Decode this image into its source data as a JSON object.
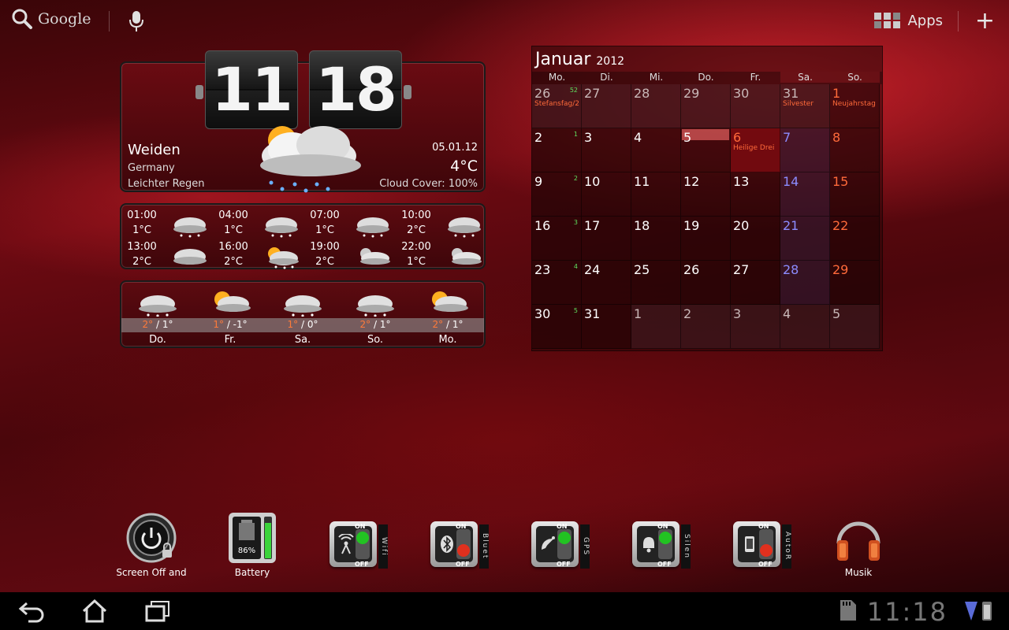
{
  "topbar": {
    "search_label": "Google",
    "apps_label": "Apps"
  },
  "clock": {
    "hours": "11",
    "minutes": "18"
  },
  "weather_now": {
    "city": "Weiden",
    "country": "Germany",
    "condition": "Leichter Regen",
    "date": "05.01.12",
    "temp": "4°C",
    "cloud_cover": "Cloud Cover: 100%"
  },
  "hourly": [
    {
      "time": "01:00",
      "temp": "1°C",
      "icon": "snow-cloud-icon"
    },
    {
      "time": "04:00",
      "temp": "1°C",
      "icon": "snow-cloud-icon"
    },
    {
      "time": "07:00",
      "temp": "1°C",
      "icon": "snow-cloud-icon"
    },
    {
      "time": "10:00",
      "temp": "2°C",
      "icon": "snow-cloud-icon"
    },
    {
      "time": "13:00",
      "temp": "2°C",
      "icon": "cloud-icon"
    },
    {
      "time": "16:00",
      "temp": "2°C",
      "icon": "sun-snow-cloud-icon"
    },
    {
      "time": "19:00",
      "temp": "2°C",
      "icon": "night-cloud-icon"
    },
    {
      "time": "22:00",
      "temp": "1°C",
      "icon": "night-cloud-icon"
    }
  ],
  "daily": [
    {
      "day": "Do.",
      "hi": "2°",
      "lo": " / 1°"
    },
    {
      "day": "Fr.",
      "hi": "1°",
      "lo": " / -1°"
    },
    {
      "day": "Sa.",
      "hi": "1°",
      "lo": " / 0°"
    },
    {
      "day": "So.",
      "hi": "2°",
      "lo": " / 1°"
    },
    {
      "day": "Mo.",
      "hi": "2°",
      "lo": " / 1°"
    }
  ],
  "calendar": {
    "month": "Januar",
    "year": "2012",
    "weekdays": [
      "Mo.",
      "Di.",
      "Mi.",
      "Do.",
      "Fr.",
      "Sa.",
      "So."
    ],
    "weeks": [
      {
        "wk": "52",
        "days": [
          "26",
          "27",
          "28",
          "29",
          "30",
          "31",
          "1"
        ]
      },
      {
        "wk": "1",
        "days": [
          "2",
          "3",
          "4",
          "5",
          "6",
          "7",
          "8"
        ]
      },
      {
        "wk": "2",
        "days": [
          "9",
          "10",
          "11",
          "12",
          "13",
          "14",
          "15"
        ]
      },
      {
        "wk": "3",
        "days": [
          "16",
          "17",
          "18",
          "19",
          "20",
          "21",
          "22"
        ]
      },
      {
        "wk": "4",
        "days": [
          "23",
          "24",
          "25",
          "26",
          "27",
          "28",
          "29"
        ]
      },
      {
        "wk": "5",
        "days": [
          "30",
          "31",
          "1",
          "2",
          "3",
          "4",
          "5"
        ]
      }
    ],
    "events": [
      {
        "week": 0,
        "day": 0,
        "text": "Stefansfag/2"
      },
      {
        "week": 0,
        "day": 5,
        "text": "Silvester"
      },
      {
        "week": 0,
        "day": 6,
        "text": "Neujahrstag"
      },
      {
        "week": 1,
        "day": 4,
        "text": "Heilige Drei"
      }
    ],
    "today": "5"
  },
  "dock": {
    "screen_off_label": "Screen Off and",
    "battery_label": "Battery",
    "battery_percent": "86%",
    "battery_level": 0.86,
    "toggles": [
      {
        "name": "wifi",
        "label": "Wifi",
        "state": "ON",
        "icon": "wifi-icon"
      },
      {
        "name": "bluetooth",
        "label": "Bluet",
        "state": "OFF",
        "icon": "bluetooth-icon"
      },
      {
        "name": "gps",
        "label": "GPS",
        "state": "ON",
        "icon": "gps-icon"
      },
      {
        "name": "silent",
        "label": "Silen",
        "state": "ON",
        "icon": "bell-icon"
      },
      {
        "name": "autorotate",
        "label": "AutoR",
        "state": "OFF",
        "icon": "phone-rotate-icon"
      }
    ],
    "on_text": "ON",
    "off_text": "OFF",
    "music_label": "Musik"
  },
  "navbar": {
    "time": "11:18"
  },
  "colors": {
    "accent_orange": "#ff6a3a",
    "weekend_blue": "#8c8cff",
    "toggle_on": "#22c322",
    "toggle_off": "#e0301e"
  }
}
